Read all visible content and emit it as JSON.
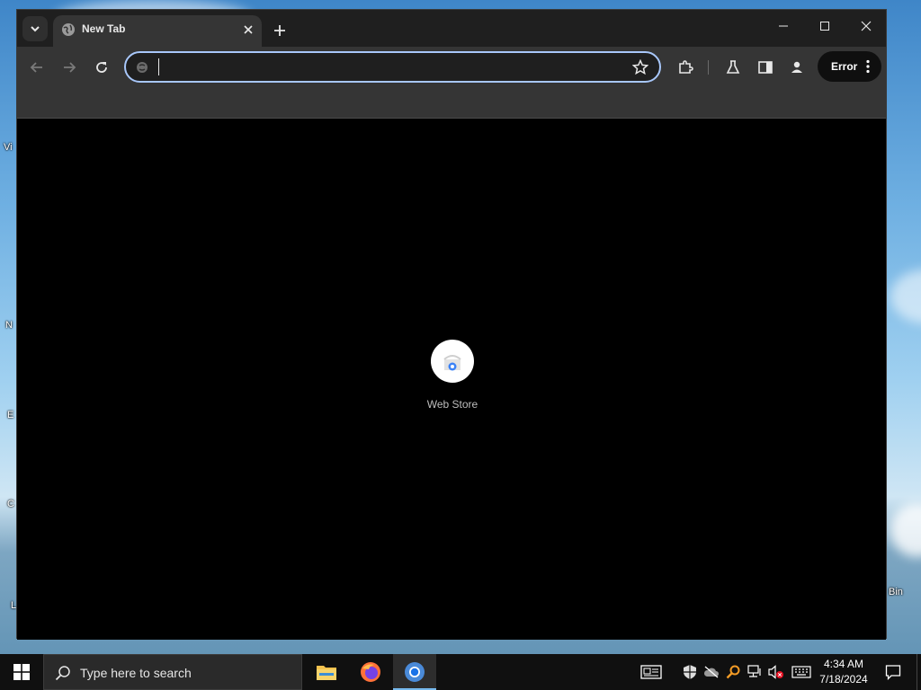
{
  "desktop": {
    "icon_labels": [
      "Vi",
      "N",
      "E",
      "C",
      "L",
      "Bin"
    ]
  },
  "browser": {
    "tab": {
      "title": "New Tab",
      "favicon": "globe-icon"
    },
    "omnibox": {
      "value": "",
      "placeholder": ""
    },
    "profile_chip": {
      "label": "Error"
    },
    "shortcuts": [
      {
        "label": "Web Store",
        "icon": "chrome-web-store-icon"
      }
    ]
  },
  "taskbar": {
    "search_placeholder": "Type here to search",
    "apps": [
      "file-explorer-icon",
      "firefox-icon",
      "chrome-icon"
    ],
    "clock": {
      "time": "4:34 AM",
      "date": "7/18/2024"
    }
  },
  "colors": {
    "accent": "#a8c7fa",
    "window_bg": "#000000",
    "toolbar_bg": "#353535",
    "taskbar_bg": "#101010"
  }
}
